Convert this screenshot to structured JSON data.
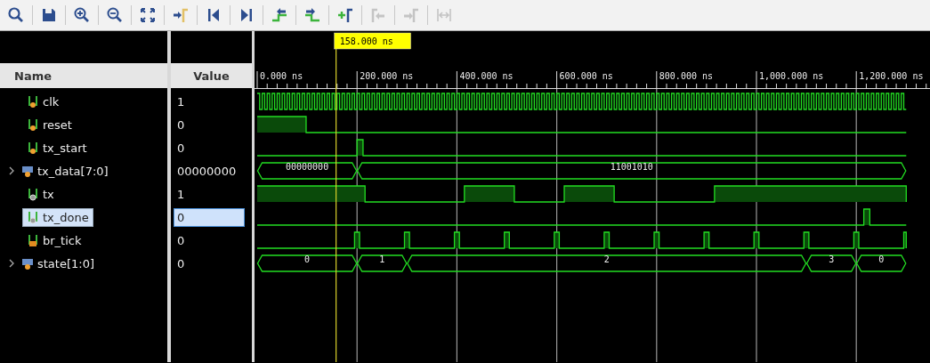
{
  "toolbar": [
    {
      "kind": "search",
      "disabled": false
    },
    {
      "kind": "save",
      "disabled": false
    },
    {
      "kind": "zoom-in",
      "disabled": false
    },
    {
      "kind": "zoom-out",
      "disabled": false
    },
    {
      "kind": "fit",
      "disabled": false
    },
    {
      "kind": "go-to-cursor",
      "disabled": false
    },
    {
      "kind": "go-to-start",
      "disabled": false
    },
    {
      "kind": "go-to-end",
      "disabled": false
    },
    {
      "kind": "prev-transition",
      "disabled": false
    },
    {
      "kind": "next-transition",
      "disabled": false
    },
    {
      "kind": "add-marker",
      "disabled": false
    },
    {
      "kind": "prev-marker",
      "disabled": true
    },
    {
      "kind": "next-marker",
      "disabled": true
    },
    {
      "kind": "swap-cursors",
      "disabled": true
    }
  ],
  "columns": {
    "name": "Name",
    "value": "Value"
  },
  "cursor": {
    "time": "158.000 ns"
  },
  "time_axis": [
    "0.000 ns",
    "200.000 ns",
    "400.000 ns",
    "600.000 ns",
    "800.000 ns",
    "1,000.000 ns",
    "1,200.000 ns"
  ],
  "signals": [
    {
      "name": "clk",
      "value": "1",
      "kind": "input",
      "selected": false
    },
    {
      "name": "reset",
      "value": "0",
      "kind": "input",
      "selected": false
    },
    {
      "name": "tx_start",
      "value": "0",
      "kind": "input",
      "selected": false
    },
    {
      "name": "tx_data[7:0]",
      "value": "00000000",
      "kind": "input-bus",
      "selected": false,
      "expanded": false,
      "segments": [
        "00000000",
        "11001010"
      ]
    },
    {
      "name": "tx",
      "value": "1",
      "kind": "output",
      "selected": false
    },
    {
      "name": "tx_done",
      "value": "0",
      "kind": "output",
      "selected": true
    },
    {
      "name": "br_tick",
      "value": "0",
      "kind": "internal",
      "selected": false
    },
    {
      "name": "state[1:0]",
      "value": "0",
      "kind": "input-bus",
      "selected": false,
      "expanded": false,
      "segments": [
        "0",
        "1",
        "2",
        "3",
        "0"
      ]
    }
  ]
}
